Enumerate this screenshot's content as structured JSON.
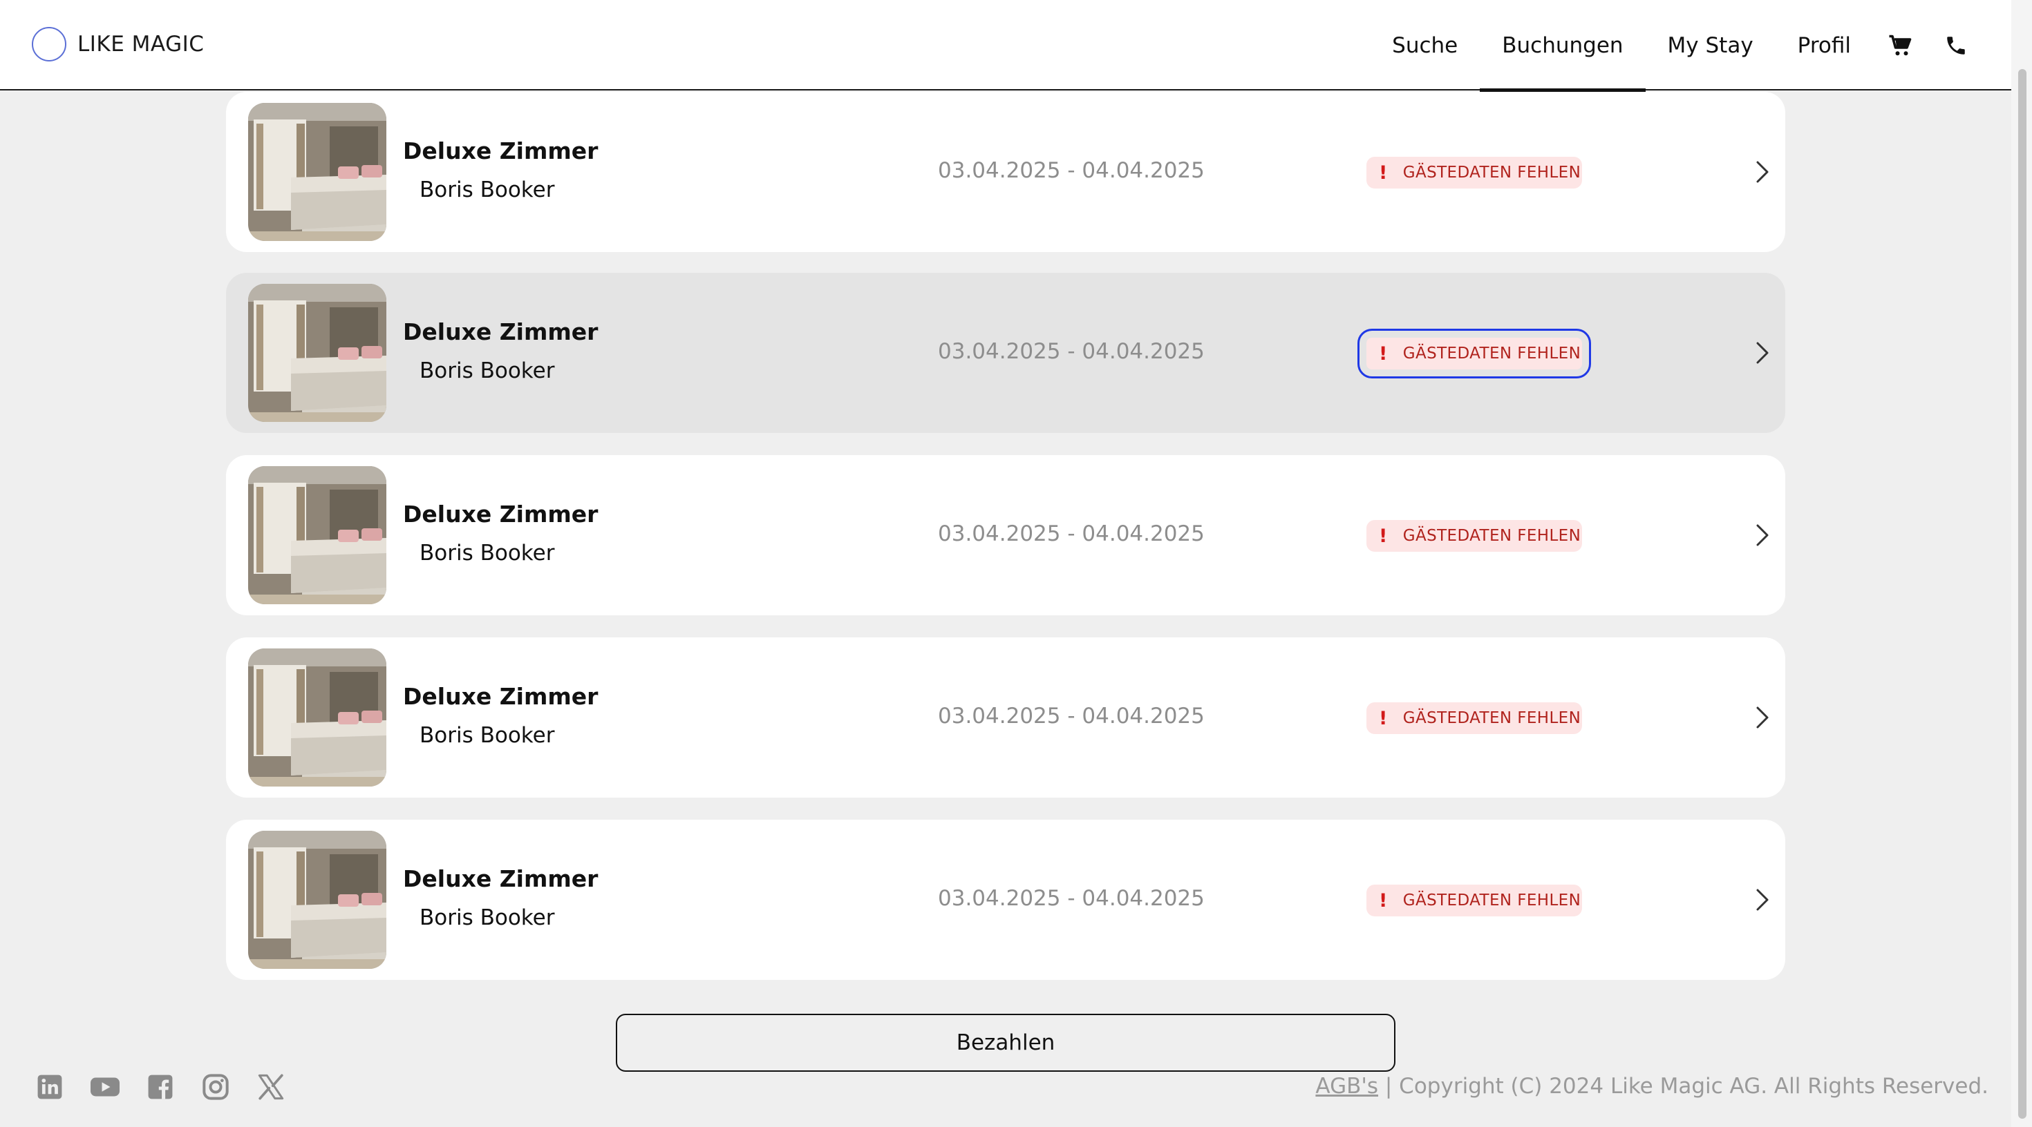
{
  "header": {
    "logo_text": "LIKE MAGIC",
    "nav": [
      {
        "label": "Suche"
      },
      {
        "label": "Buchungen",
        "active": true
      },
      {
        "label": "My Stay"
      },
      {
        "label": "Profil"
      }
    ],
    "icons": [
      "cart-icon",
      "phone-icon"
    ]
  },
  "bookings": [
    {
      "room": "Deluxe Zimmer",
      "guest": "Boris Booker",
      "dates": "03.04.2025 - 04.04.2025",
      "status": "GÄSTEDATEN FEHLEN"
    },
    {
      "room": "Deluxe Zimmer",
      "guest": "Boris Booker",
      "dates": "03.04.2025 - 04.04.2025",
      "status": "GÄSTEDATEN FEHLEN"
    },
    {
      "room": "Deluxe Zimmer",
      "guest": "Boris Booker",
      "dates": "03.04.2025 - 04.04.2025",
      "status": "GÄSTEDATEN FEHLEN"
    },
    {
      "room": "Deluxe Zimmer",
      "guest": "Boris Booker",
      "dates": "03.04.2025 - 04.04.2025",
      "status": "GÄSTEDATEN FEHLEN"
    },
    {
      "room": "Deluxe Zimmer",
      "guest": "Boris Booker",
      "dates": "03.04.2025 - 04.04.2025",
      "status": "GÄSTEDATEN FEHLEN"
    }
  ],
  "status_icon": "!",
  "pay_button": {
    "label": "Bezahlen"
  },
  "footer": {
    "agb": "AGB's",
    "copyright": " | Copyright (C) 2024 Like Magic AG. All Rights Reserved.",
    "socials": [
      "linkedin-icon",
      "youtube-icon",
      "facebook-icon",
      "instagram-icon",
      "x-icon"
    ]
  },
  "colors": {
    "accent_logo": "#5b6fd6",
    "status_text": "#b0231d",
    "status_bg": "#fde5e5",
    "focus_outline": "#1f39e6",
    "page_bg": "#efefef"
  }
}
